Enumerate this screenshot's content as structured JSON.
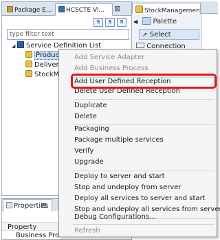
{
  "left_view": {
    "tabs": [
      {
        "label": "Package E..."
      },
      {
        "label": "HCSCTE Vi..."
      }
    ],
    "close_glyph": "⊠",
    "toolbar_buttons": [
      "S",
      "S",
      "S"
    ],
    "filter": {
      "placeholder": "type filter text",
      "value": ""
    },
    "tree": {
      "root": "Service Definition List",
      "children": [
        "ProductA",
        "Delivery",
        "StockMa"
      ]
    }
  },
  "properties_view": {
    "tab_label": "Properties",
    "close_glyph": "⊠",
    "column_header": "Property",
    "row_label": "Business Process Name"
  },
  "editor": {
    "tab_label": "StockManagement",
    "palette": {
      "title": "Palette",
      "items": [
        "Select",
        "Connection"
      ]
    }
  },
  "context_menu": {
    "groups": [
      [
        {
          "label": "Add Service Adapter",
          "enabled": false
        },
        {
          "label": "Add Business Process",
          "enabled": false
        }
      ],
      [
        {
          "label": "Add User Defined Reception",
          "enabled": true,
          "highlighted": true
        },
        {
          "label": "Delete User Defined Reception",
          "enabled": true
        }
      ],
      [
        {
          "label": "Duplicate",
          "enabled": true
        },
        {
          "label": "Delete",
          "enabled": true
        }
      ],
      [
        {
          "label": "Packaging",
          "enabled": true
        },
        {
          "label": "Package multiple services",
          "enabled": true
        },
        {
          "label": "Verify",
          "enabled": true
        },
        {
          "label": "Upgrade",
          "enabled": true
        }
      ],
      [
        {
          "label": "Deploy to server and start",
          "enabled": true
        },
        {
          "label": "Stop and undeploy from server",
          "enabled": true
        },
        {
          "label": "Deploy all services to server and start",
          "enabled": true
        },
        {
          "label": "Stop and undeploy all services from server",
          "enabled": true
        }
      ],
      [
        {
          "label": "Debug Configurations...",
          "enabled": true
        }
      ],
      [
        {
          "label": "Refresh",
          "enabled": false
        }
      ]
    ]
  },
  "colors": {
    "highlight_outline": "#e8141c",
    "menu_background": "#f5f5f5",
    "view_border": "#9aa9bd"
  }
}
